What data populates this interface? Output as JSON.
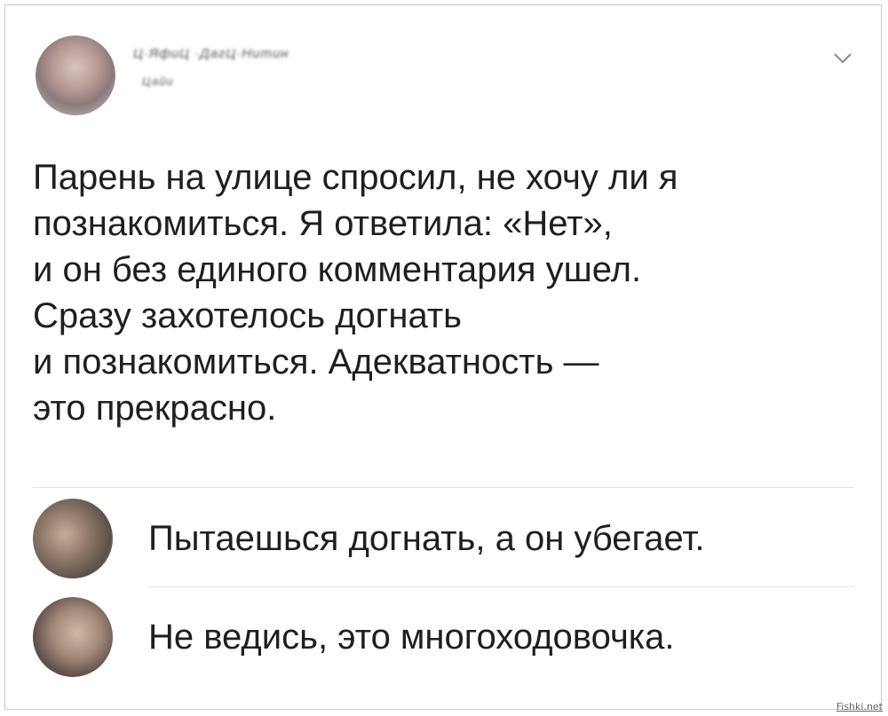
{
  "post": {
    "author_name": "Ц·ЯфиЦ ·ДагЦ·Нитин",
    "author_handle": "Цайи",
    "text_lines": [
      "Парень на улице спросил, не хочу ли я",
      "познакомиться. Я ответила: «Нет»,",
      "и он без единого комментария ушел.",
      "Сразу захотелось догнать",
      "и познакомиться. Адекватность —",
      "это прекрасно."
    ]
  },
  "comments": [
    {
      "text": "Пытаешься догнать, а он убегает."
    },
    {
      "text": "Не ведись, это многоходовочка."
    }
  ],
  "watermark": "Fishki.net"
}
